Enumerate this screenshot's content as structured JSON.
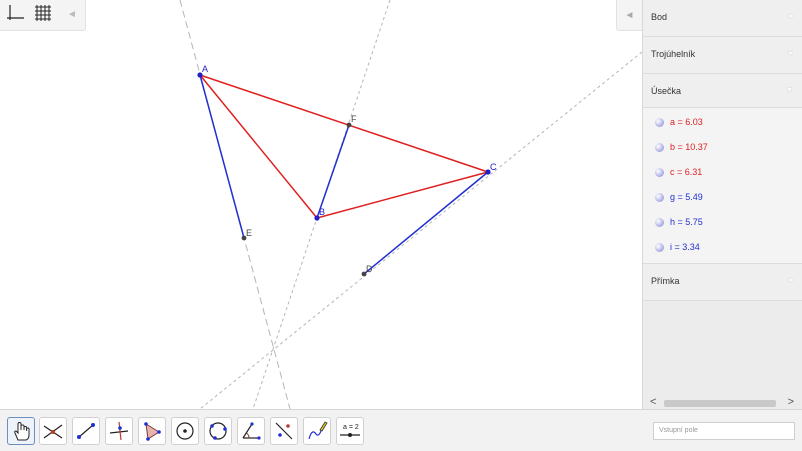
{
  "graphics": {
    "points": [
      {
        "label": "A",
        "color": "#2020c8"
      },
      {
        "label": "B",
        "color": "#2020c8"
      },
      {
        "label": "C",
        "color": "#2020c8"
      },
      {
        "label": "D",
        "color": "#444444"
      },
      {
        "label": "E",
        "color": "#444444"
      },
      {
        "label": "F",
        "color": "#444444"
      }
    ],
    "segment_color_red": "#e02020",
    "segment_color_blue": "#2030d0",
    "auxline_color": "#b0b0b0"
  },
  "algebra": {
    "sections": [
      {
        "label": "Bod",
        "arrow": "◄"
      },
      {
        "label": "Trojúhelník",
        "arrow": "◄"
      },
      {
        "label": "Úsečka",
        "arrow": "▼"
      },
      {
        "label": "Přímka",
        "arrow": "◄"
      }
    ],
    "items": [
      {
        "text": "a = 6.03",
        "color": "#e02020"
      },
      {
        "text": "b = 10.37",
        "color": "#e02020"
      },
      {
        "text": "c = 6.31",
        "color": "#e02020"
      },
      {
        "text": "g = 5.49",
        "color": "#2030d0"
      },
      {
        "text": "h = 5.75",
        "color": "#2030d0"
      },
      {
        "text": "i = 3.34",
        "color": "#2030d0"
      }
    ],
    "scroll_left": "<",
    "scroll_right": ">"
  },
  "style_bar": {
    "buttons": [
      {
        "icon": "axes-icon"
      },
      {
        "icon": "grid-icon"
      }
    ],
    "collapse_arrow": "◄"
  },
  "algebra_toggle_arrow": "◄",
  "toolbar": {
    "tools": [
      {
        "icon": "move-hand-icon",
        "active": true
      },
      {
        "icon": "intersect-point-icon"
      },
      {
        "icon": "segment-icon"
      },
      {
        "icon": "perpendicular-line-icon"
      },
      {
        "icon": "polygon-icon"
      },
      {
        "icon": "circle-center-icon"
      },
      {
        "icon": "circle-three-points-icon"
      },
      {
        "icon": "angle-icon"
      },
      {
        "icon": "reflect-icon"
      },
      {
        "icon": "pen-icon"
      },
      {
        "icon": "slider-icon",
        "label": "a = 2"
      }
    ],
    "input_placeholder": "Vstupní pole"
  }
}
